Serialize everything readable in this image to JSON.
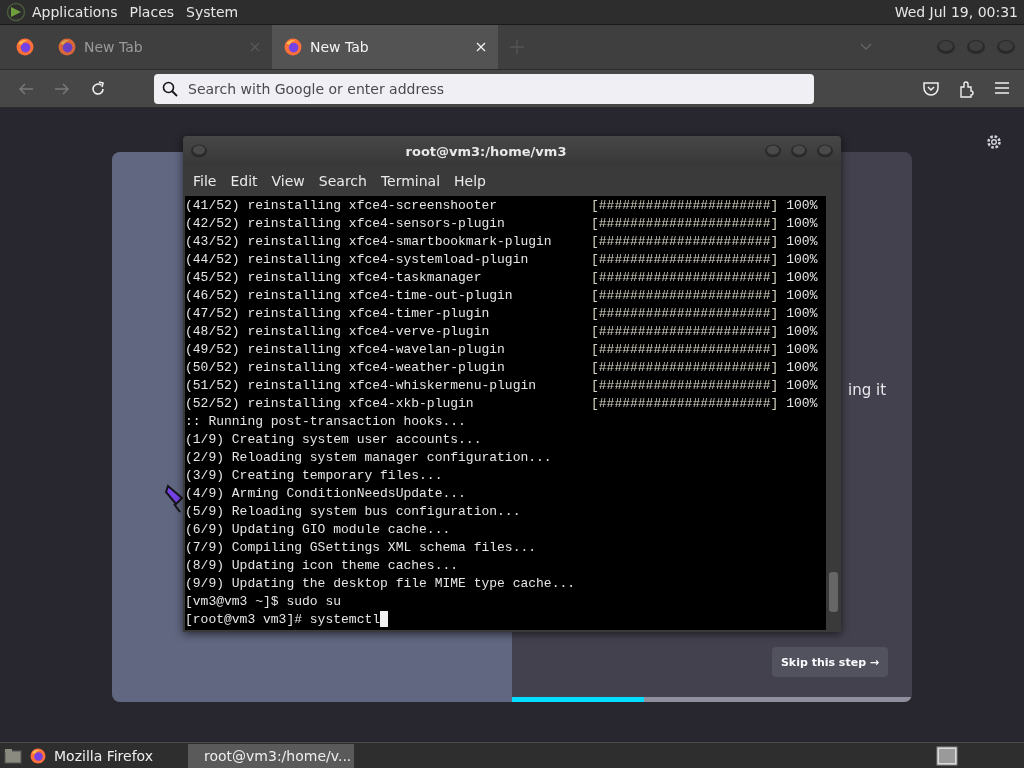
{
  "top_panel": {
    "menus": [
      "Applications",
      "Places",
      "System"
    ],
    "clock": "Wed Jul 19, 00:31"
  },
  "browser": {
    "tabs": [
      {
        "kind": "pinned",
        "selected": false
      },
      {
        "kind": "normal",
        "label": "New Tab",
        "selected": false
      },
      {
        "kind": "normal",
        "label": "New Tab",
        "selected": true
      }
    ],
    "back_disabled": true,
    "forward_disabled": true,
    "address_bar": {
      "placeholder": "Search with Google or enter address"
    },
    "onboarding": {
      "partial_text": "ing it",
      "skip_button": "Skip this step →",
      "level": 0.33
    }
  },
  "terminal": {
    "title": "root@vm3:/home/vm3",
    "menus": [
      "File",
      "Edit",
      "View",
      "Search",
      "Terminal",
      "Help"
    ],
    "cursor_visible": true,
    "lines": [
      {
        "text": "(41/52) reinstalling xfce4-screenshooter",
        "bar": "[######################]",
        "percent": "100%"
      },
      {
        "text": "(42/52) reinstalling xfce4-sensors-plugin",
        "bar": "[######################]",
        "percent": "100%"
      },
      {
        "text": "(43/52) reinstalling xfce4-smartbookmark-plugin",
        "bar": "[######################]",
        "percent": "100%"
      },
      {
        "text": "(44/52) reinstalling xfce4-systemload-plugin",
        "bar": "[######################]",
        "percent": "100%"
      },
      {
        "text": "(45/52) reinstalling xfce4-taskmanager",
        "bar": "[######################]",
        "percent": "100%"
      },
      {
        "text": "(46/52) reinstalling xfce4-time-out-plugin",
        "bar": "[######################]",
        "percent": "100%"
      },
      {
        "text": "(47/52) reinstalling xfce4-timer-plugin",
        "bar": "[######################]",
        "percent": "100%"
      },
      {
        "text": "(48/52) reinstalling xfce4-verve-plugin",
        "bar": "[######################]",
        "percent": "100%"
      },
      {
        "text": "(49/52) reinstalling xfce4-wavelan-plugin",
        "bar": "[######################]",
        "percent": "100%"
      },
      {
        "text": "(50/52) reinstalling xfce4-weather-plugin",
        "bar": "[######################]",
        "percent": "100%"
      },
      {
        "text": "(51/52) reinstalling xfce4-whiskermenu-plugin",
        "bar": "[######################]",
        "percent": "100%"
      },
      {
        "text": "(52/52) reinstalling xfce4-xkb-plugin",
        "bar": "[######################]",
        "percent": "100%"
      },
      {
        "text": ":: Running post-transaction hooks..."
      },
      {
        "text": "(1/9) Creating system user accounts..."
      },
      {
        "text": "(2/9) Reloading system manager configuration..."
      },
      {
        "text": "(3/9) Creating temporary files..."
      },
      {
        "text": "(4/9) Arming ConditionNeedsUpdate..."
      },
      {
        "text": "(5/9) Reloading system bus configuration..."
      },
      {
        "text": "(6/9) Updating GIO module cache..."
      },
      {
        "text": "(7/9) Compiling GSettings XML schema files..."
      },
      {
        "text": "(8/9) Updating icon theme caches..."
      },
      {
        "text": "(9/9) Updating the desktop file MIME type cache..."
      },
      {
        "text": "[vm3@vm3 ~]$ sudo su"
      },
      {
        "text": "[root@vm3 vm3]# systemctl"
      }
    ]
  },
  "taskbar": {
    "tasks": [
      {
        "kind": "browser",
        "label": "Mozilla Firefox",
        "selected": false
      },
      {
        "kind": "terminal",
        "label": "root@vm3:/home/v...",
        "selected": true
      }
    ]
  }
}
